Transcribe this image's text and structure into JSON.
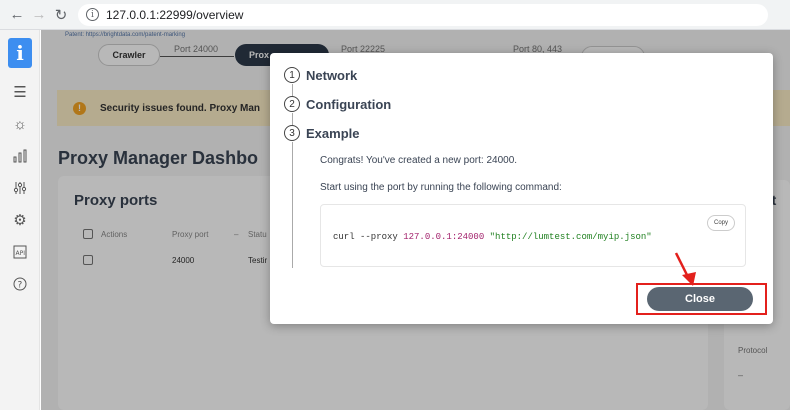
{
  "browser": {
    "back_icon": "arrow-left-icon",
    "forward_icon": "arrow-right-icon",
    "reload_icon": "reload-icon",
    "url": "127.0.0.1:22999/overview"
  },
  "sidebar": {
    "logo": "i",
    "items": [
      "document-icon",
      "bulb-icon",
      "bar-chart-icon",
      "sliders-icon",
      "gear-icon",
      "api-icon",
      "help-icon"
    ]
  },
  "header": {
    "patent": "Patent: https://brightdata.com/patent-marking",
    "flow": {
      "crawler": "Crawler",
      "port1": "Port 24000",
      "proxy": "Prox",
      "port2": "Port 22225",
      "port3": "Port 80, 443"
    }
  },
  "alert": {
    "text": "Security issues found. Proxy Man"
  },
  "page_title": "Proxy Manager Dashbo",
  "ports_card": {
    "title": "Proxy ports",
    "columns": [
      "Actions",
      "Proxy port",
      "Statu"
    ],
    "rows": [
      {
        "port": "24000",
        "status": "Testir"
      }
    ]
  },
  "right_panel": {
    "title": "ist",
    "protocol_label": "Protocol",
    "protocol_value": "–"
  },
  "modal": {
    "steps": [
      {
        "num": "1",
        "label": "Network"
      },
      {
        "num": "2",
        "label": "Configuration"
      },
      {
        "num": "3",
        "label": "Example"
      }
    ],
    "congrats": "Congrats! You've created a new port: 24000.",
    "instruction": "Start using the port by running the following command:",
    "code": {
      "cmd": "curl --proxy ",
      "ip": "127.0.0.1:24000",
      "url": "\"http://lumtest.com/myip.json\""
    },
    "copy_label": "Copy",
    "close_label": "Close"
  },
  "colors": {
    "accent": "#3d8ef0",
    "close_button": "#5a6672",
    "highlight": "#e3201c",
    "alert_bg": "#fbedc7"
  }
}
